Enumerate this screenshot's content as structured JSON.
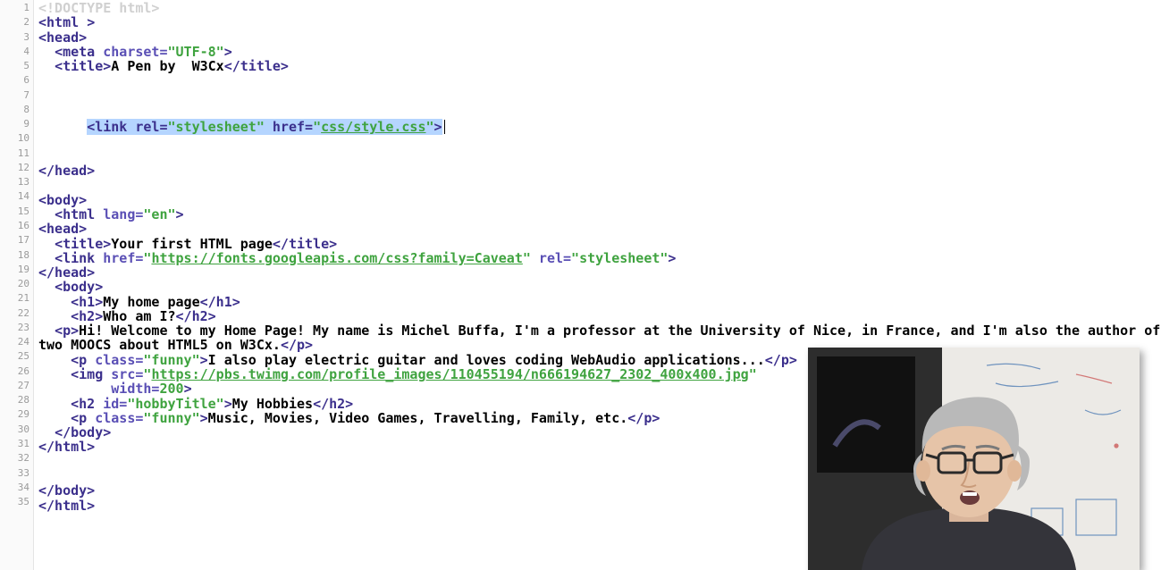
{
  "editor": {
    "total_lines": 35,
    "selection_line": 9,
    "selection_html_prefix": "<span class='sel'><span class='t-tag'>&lt;link</span> <span class='t-attr'>rel=</span><span class='t-str'>\"stylesheet\"</span> <span class='t-attr'>href=</span><span class='t-str'>\"<span class='url'>css/style.css</span>\"</span><span class='t-tag'>&gt;</span></span>",
    "line_numbers": [
      "1",
      "2",
      "3",
      "4",
      "5",
      "6",
      "7",
      "8",
      "9",
      "10",
      "11",
      "12",
      "13",
      "14",
      "15",
      "16",
      "17",
      "18",
      "19",
      "20",
      "21",
      "22",
      "23",
      "24",
      "25",
      "26",
      "27",
      "28",
      "29",
      "30",
      "31",
      "32",
      "33",
      "34",
      "35"
    ],
    "lines_html": [
      "<span class='t-doc'>&lt;!DOCTYPE html&gt;</span>",
      "<span class='t-tag'>&lt;html</span> <span class='t-tag'>&gt;</span>",
      "<span class='t-tag'>&lt;head&gt;</span>",
      "  <span class='t-tag'>&lt;meta</span> <span class='t-attr'>charset=</span><span class='t-str'>\"UTF-8\"</span><span class='t-tag'>&gt;</span>",
      "  <span class='t-tag'>&lt;title&gt;</span><span class='t-txt'>A Pen by  W3Cx</span><span class='t-tag'>&lt;/title&gt;</span>",
      "",
      "",
      "",
      "__SELECTION__",
      "",
      "",
      "<span class='t-tag'>&lt;/head&gt;</span>",
      "",
      "<span class='t-tag'>&lt;body&gt;</span>",
      "  <span class='t-tag'>&lt;html</span> <span class='t-attr'>lang=</span><span class='t-str'>\"en\"</span><span class='t-tag'>&gt;</span>",
      "<span class='t-tag'>&lt;head&gt;</span>",
      "  <span class='t-tag'>&lt;title&gt;</span><span class='t-txt'>Your first HTML page</span><span class='t-tag'>&lt;/title&gt;</span>",
      "  <span class='t-tag'>&lt;link</span> <span class='t-attr'>href=</span><span class='t-str'>\"<span class='url'>https://fonts.googleapis.com/css?family=Caveat</span>\"</span> <span class='t-attr'>rel=</span><span class='t-str'>\"stylesheet\"</span><span class='t-tag'>&gt;</span>",
      "<span class='t-tag'>&lt;/head&gt;</span>",
      "  <span class='t-tag'>&lt;body&gt;</span>",
      "    <span class='t-tag'>&lt;h1&gt;</span><span class='t-txt'>My home page</span><span class='t-tag'>&lt;/h1&gt;</span>",
      "    <span class='t-tag'>&lt;h2&gt;</span><span class='t-txt'>Who am I?</span><span class='t-tag'>&lt;/h2&gt;</span>",
      "  <span class='t-tag'>&lt;p&gt;</span><span class='t-txt'>Hi! Welcome to my Home Page! My name is Michel Buffa, I'm a professor at the University of Nice, in France, and I'm also the author of two MOOCS about HTML5 on W3Cx.</span><span class='t-tag'>&lt;/p&gt;</span>",
      "    <span class='t-tag'>&lt;p</span> <span class='t-attr'>class=</span><span class='t-str'>\"funny\"</span><span class='t-tag'>&gt;</span><span class='t-txt'>I also play electric guitar and loves coding WebAudio applications...</span><span class='t-tag'>&lt;/p&gt;</span>",
      "    <span class='t-tag'>&lt;img</span> <span class='t-attr'>src=</span><span class='t-str'>\"<span class='url'>https://pbs.twimg.com/profile_images/110455194/n666194627_2302_400x400.jpg</span>\"</span>",
      "         <span class='t-attr'>width=</span><span class='t-str'>200</span><span class='t-tag'>&gt;</span>",
      "    <span class='t-tag'>&lt;h2</span> <span class='t-attr'>id=</span><span class='t-str'>\"hobbyTitle\"</span><span class='t-tag'>&gt;</span><span class='t-txt'>My Hobbies</span><span class='t-tag'>&lt;/h2&gt;</span>",
      "    <span class='t-tag'>&lt;p</span> <span class='t-attr'>class=</span><span class='t-str'>\"funny\"</span><span class='t-tag'>&gt;</span><span class='t-txt'>Music, Movies, Video Games, Travelling, Family, etc.</span><span class='t-tag'>&lt;/p&gt;</span>",
      "  <span class='t-tag'>&lt;/body&gt;</span>",
      "<span class='t-tag'>&lt;/html&gt;</span>",
      "",
      "",
      "<span class='t-tag'>&lt;/body&gt;</span>",
      "<span class='t-tag'>&lt;/html&gt;</span>",
      ""
    ]
  },
  "webcam": {
    "present": true,
    "description": "presenter-video"
  }
}
